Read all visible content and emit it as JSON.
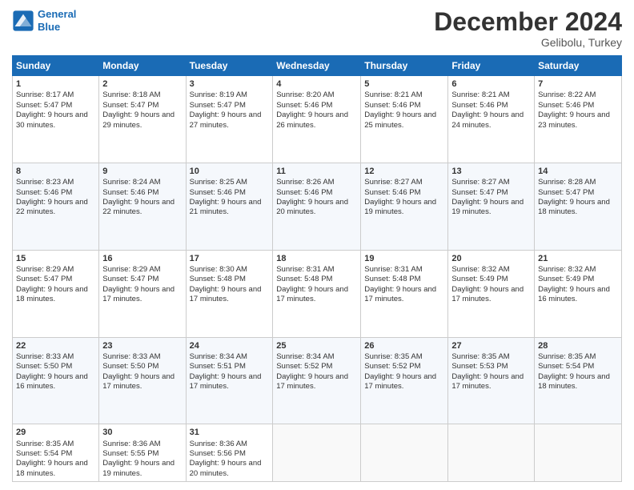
{
  "logo": {
    "line1": "General",
    "line2": "Blue"
  },
  "title": "December 2024",
  "subtitle": "Gelibolu, Turkey",
  "days_header": [
    "Sunday",
    "Monday",
    "Tuesday",
    "Wednesday",
    "Thursday",
    "Friday",
    "Saturday"
  ],
  "weeks": [
    [
      {
        "day": "1",
        "sunrise": "Sunrise: 8:17 AM",
        "sunset": "Sunset: 5:47 PM",
        "daylight": "Daylight: 9 hours and 30 minutes."
      },
      {
        "day": "2",
        "sunrise": "Sunrise: 8:18 AM",
        "sunset": "Sunset: 5:47 PM",
        "daylight": "Daylight: 9 hours and 29 minutes."
      },
      {
        "day": "3",
        "sunrise": "Sunrise: 8:19 AM",
        "sunset": "Sunset: 5:47 PM",
        "daylight": "Daylight: 9 hours and 27 minutes."
      },
      {
        "day": "4",
        "sunrise": "Sunrise: 8:20 AM",
        "sunset": "Sunset: 5:46 PM",
        "daylight": "Daylight: 9 hours and 26 minutes."
      },
      {
        "day": "5",
        "sunrise": "Sunrise: 8:21 AM",
        "sunset": "Sunset: 5:46 PM",
        "daylight": "Daylight: 9 hours and 25 minutes."
      },
      {
        "day": "6",
        "sunrise": "Sunrise: 8:21 AM",
        "sunset": "Sunset: 5:46 PM",
        "daylight": "Daylight: 9 hours and 24 minutes."
      },
      {
        "day": "7",
        "sunrise": "Sunrise: 8:22 AM",
        "sunset": "Sunset: 5:46 PM",
        "daylight": "Daylight: 9 hours and 23 minutes."
      }
    ],
    [
      {
        "day": "8",
        "sunrise": "Sunrise: 8:23 AM",
        "sunset": "Sunset: 5:46 PM",
        "daylight": "Daylight: 9 hours and 22 minutes."
      },
      {
        "day": "9",
        "sunrise": "Sunrise: 8:24 AM",
        "sunset": "Sunset: 5:46 PM",
        "daylight": "Daylight: 9 hours and 22 minutes."
      },
      {
        "day": "10",
        "sunrise": "Sunrise: 8:25 AM",
        "sunset": "Sunset: 5:46 PM",
        "daylight": "Daylight: 9 hours and 21 minutes."
      },
      {
        "day": "11",
        "sunrise": "Sunrise: 8:26 AM",
        "sunset": "Sunset: 5:46 PM",
        "daylight": "Daylight: 9 hours and 20 minutes."
      },
      {
        "day": "12",
        "sunrise": "Sunrise: 8:27 AM",
        "sunset": "Sunset: 5:46 PM",
        "daylight": "Daylight: 9 hours and 19 minutes."
      },
      {
        "day": "13",
        "sunrise": "Sunrise: 8:27 AM",
        "sunset": "Sunset: 5:47 PM",
        "daylight": "Daylight: 9 hours and 19 minutes."
      },
      {
        "day": "14",
        "sunrise": "Sunrise: 8:28 AM",
        "sunset": "Sunset: 5:47 PM",
        "daylight": "Daylight: 9 hours and 18 minutes."
      }
    ],
    [
      {
        "day": "15",
        "sunrise": "Sunrise: 8:29 AM",
        "sunset": "Sunset: 5:47 PM",
        "daylight": "Daylight: 9 hours and 18 minutes."
      },
      {
        "day": "16",
        "sunrise": "Sunrise: 8:29 AM",
        "sunset": "Sunset: 5:47 PM",
        "daylight": "Daylight: 9 hours and 17 minutes."
      },
      {
        "day": "17",
        "sunrise": "Sunrise: 8:30 AM",
        "sunset": "Sunset: 5:48 PM",
        "daylight": "Daylight: 9 hours and 17 minutes."
      },
      {
        "day": "18",
        "sunrise": "Sunrise: 8:31 AM",
        "sunset": "Sunset: 5:48 PM",
        "daylight": "Daylight: 9 hours and 17 minutes."
      },
      {
        "day": "19",
        "sunrise": "Sunrise: 8:31 AM",
        "sunset": "Sunset: 5:48 PM",
        "daylight": "Daylight: 9 hours and 17 minutes."
      },
      {
        "day": "20",
        "sunrise": "Sunrise: 8:32 AM",
        "sunset": "Sunset: 5:49 PM",
        "daylight": "Daylight: 9 hours and 17 minutes."
      },
      {
        "day": "21",
        "sunrise": "Sunrise: 8:32 AM",
        "sunset": "Sunset: 5:49 PM",
        "daylight": "Daylight: 9 hours and 16 minutes."
      }
    ],
    [
      {
        "day": "22",
        "sunrise": "Sunrise: 8:33 AM",
        "sunset": "Sunset: 5:50 PM",
        "daylight": "Daylight: 9 hours and 16 minutes."
      },
      {
        "day": "23",
        "sunrise": "Sunrise: 8:33 AM",
        "sunset": "Sunset: 5:50 PM",
        "daylight": "Daylight: 9 hours and 17 minutes."
      },
      {
        "day": "24",
        "sunrise": "Sunrise: 8:34 AM",
        "sunset": "Sunset: 5:51 PM",
        "daylight": "Daylight: 9 hours and 17 minutes."
      },
      {
        "day": "25",
        "sunrise": "Sunrise: 8:34 AM",
        "sunset": "Sunset: 5:52 PM",
        "daylight": "Daylight: 9 hours and 17 minutes."
      },
      {
        "day": "26",
        "sunrise": "Sunrise: 8:35 AM",
        "sunset": "Sunset: 5:52 PM",
        "daylight": "Daylight: 9 hours and 17 minutes."
      },
      {
        "day": "27",
        "sunrise": "Sunrise: 8:35 AM",
        "sunset": "Sunset: 5:53 PM",
        "daylight": "Daylight: 9 hours and 17 minutes."
      },
      {
        "day": "28",
        "sunrise": "Sunrise: 8:35 AM",
        "sunset": "Sunset: 5:54 PM",
        "daylight": "Daylight: 9 hours and 18 minutes."
      }
    ],
    [
      {
        "day": "29",
        "sunrise": "Sunrise: 8:35 AM",
        "sunset": "Sunset: 5:54 PM",
        "daylight": "Daylight: 9 hours and 18 minutes."
      },
      {
        "day": "30",
        "sunrise": "Sunrise: 8:36 AM",
        "sunset": "Sunset: 5:55 PM",
        "daylight": "Daylight: 9 hours and 19 minutes."
      },
      {
        "day": "31",
        "sunrise": "Sunrise: 8:36 AM",
        "sunset": "Sunset: 5:56 PM",
        "daylight": "Daylight: 9 hours and 20 minutes."
      },
      null,
      null,
      null,
      null
    ]
  ]
}
